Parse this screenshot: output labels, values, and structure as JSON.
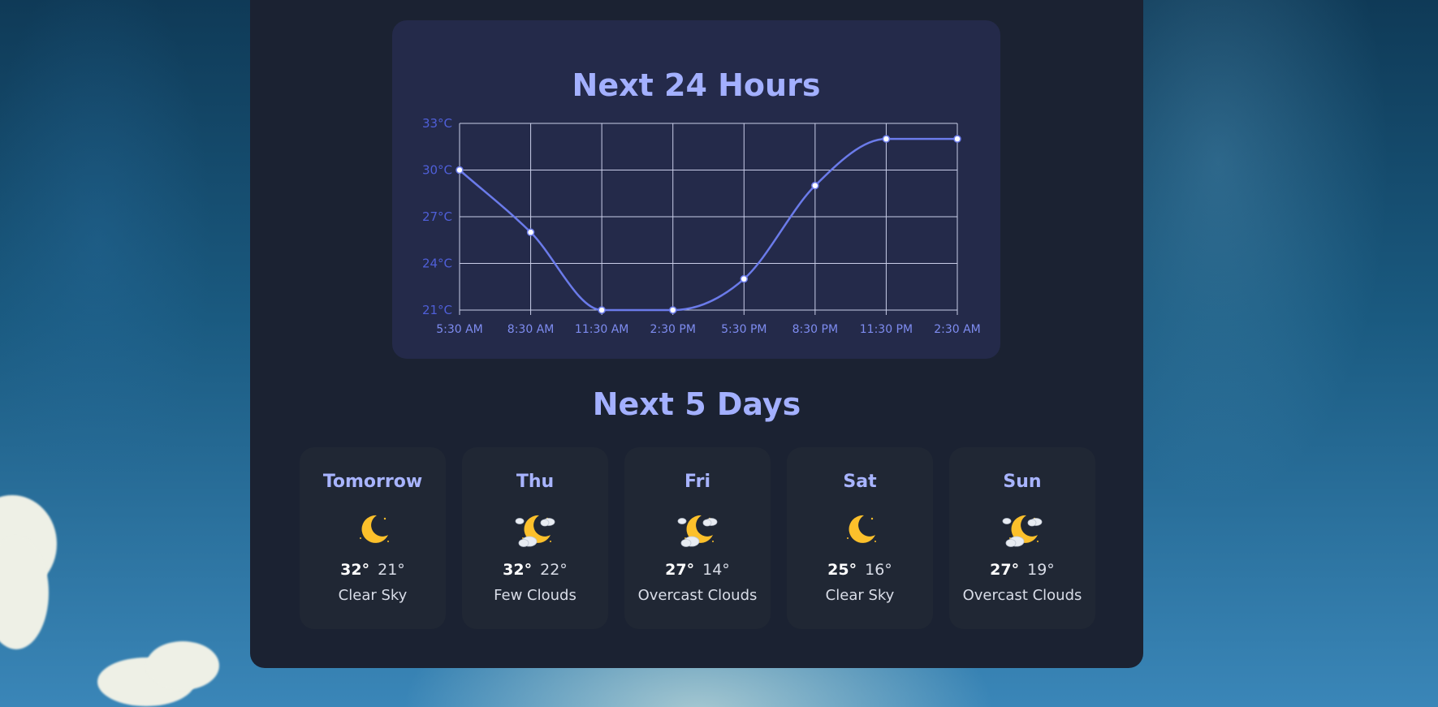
{
  "hourly": {
    "title": "Next 24 Hours",
    "chart_data": {
      "type": "line",
      "x": [
        "5:30 AM",
        "8:30 AM",
        "11:30 AM",
        "2:30 PM",
        "5:30 PM",
        "8:30 PM",
        "11:30 PM",
        "2:30 AM"
      ],
      "series": [
        {
          "values": [
            30,
            26,
            21,
            21,
            23,
            29,
            32,
            32
          ]
        }
      ],
      "ylim": [
        21,
        33
      ],
      "yticks": [
        "21°C",
        "24°C",
        "27°C",
        "30°C",
        "33°C"
      ],
      "grid": true,
      "line_color": "#6b7bea",
      "axis_label_color": "#4f5fd8"
    }
  },
  "daily": {
    "title": "Next 5 Days",
    "days": [
      {
        "name": "Tomorrow",
        "high": "32°",
        "low": "21°",
        "desc": "Clear Sky",
        "icon": "moon-icon"
      },
      {
        "name": "Thu",
        "high": "32°",
        "low": "22°",
        "desc": "Few Clouds",
        "icon": "moon-clouds-icon"
      },
      {
        "name": "Fri",
        "high": "27°",
        "low": "14°",
        "desc": "Overcast Clouds",
        "icon": "moon-clouds-icon"
      },
      {
        "name": "Sat",
        "high": "25°",
        "low": "16°",
        "desc": "Clear Sky",
        "icon": "moon-icon"
      },
      {
        "name": "Sun",
        "high": "27°",
        "low": "19°",
        "desc": "Overcast Clouds",
        "icon": "moon-clouds-icon"
      }
    ]
  },
  "colors": {
    "accent": "#a3b0ff",
    "panel": "#1b2232",
    "chart_card": "#242a4a",
    "moon": "#fcc02b"
  }
}
